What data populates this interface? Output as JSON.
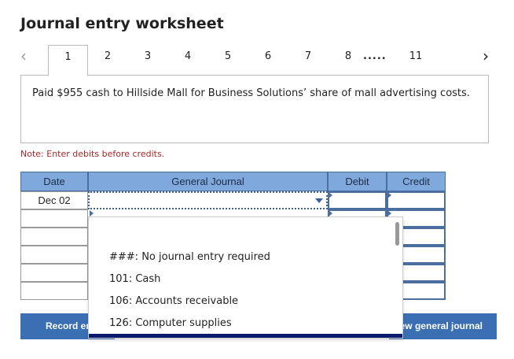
{
  "title": "Journal entry worksheet",
  "tabs": {
    "items": [
      "1",
      "2",
      "3",
      "4",
      "5",
      "6",
      "7",
      "8",
      "11"
    ],
    "dots": ".....",
    "active": "1"
  },
  "description": "Paid $955 cash to Hillside Mall for Business Solutions’ share of mall advertising costs.",
  "note": "Note: Enter debits before credits.",
  "table": {
    "headers": {
      "date": "Date",
      "journal": "General Journal",
      "debit": "Debit",
      "credit": "Credit"
    },
    "first_date": "Dec 02"
  },
  "dropdown": {
    "options": [
      "###: No journal entry required",
      "101: Cash",
      "106: Accounts receivable",
      "126: Computer supplies"
    ]
  },
  "buttons": {
    "record": "Record entry",
    "view": "View general journal"
  },
  "colors": {
    "header_bg": "#7fa9dc",
    "button_bg": "#3a6fb4",
    "note": "#a52a2a"
  }
}
